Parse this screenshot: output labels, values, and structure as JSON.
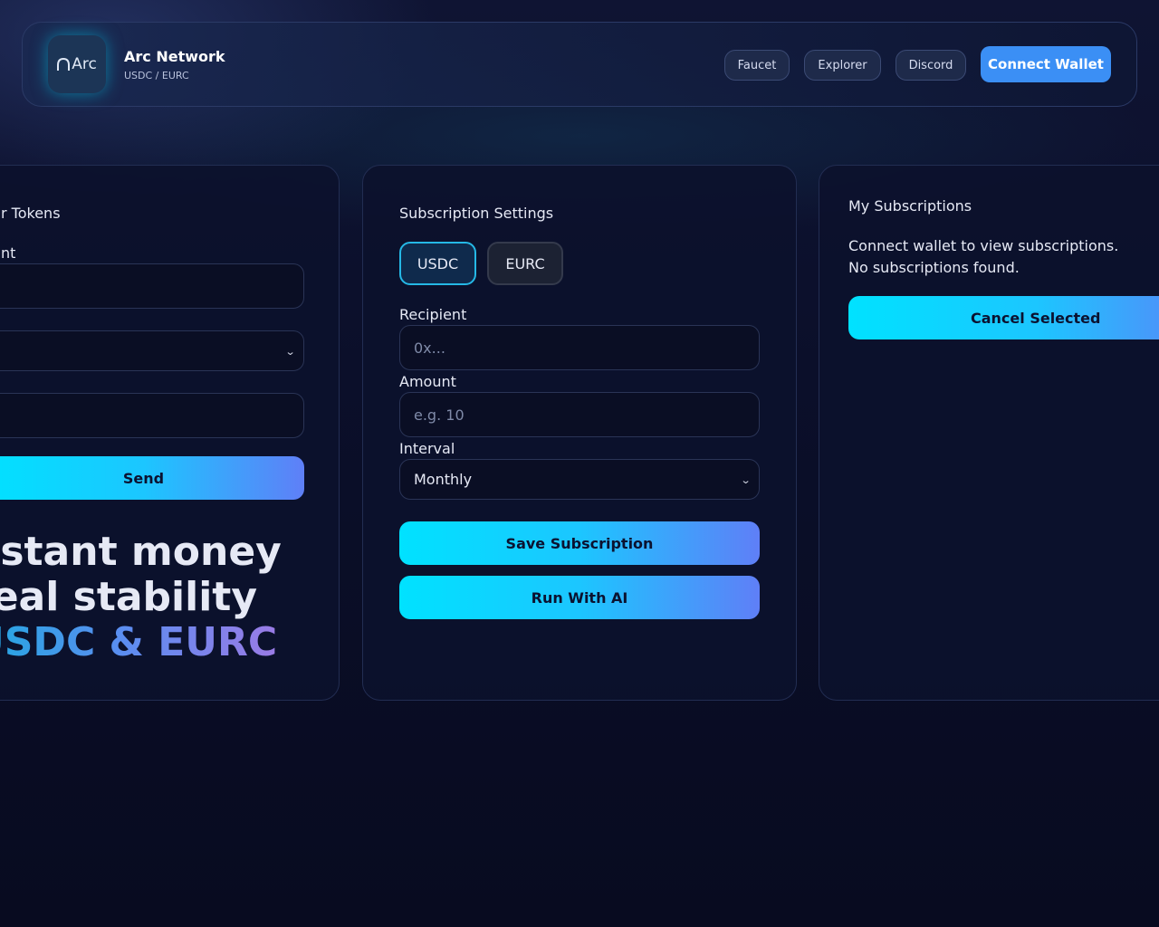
{
  "header": {
    "logo_text": "Arc",
    "title": "Arc Network",
    "subtitle": "USDC / EURC",
    "nav": [
      "Faucet",
      "Explorer",
      "Discord"
    ],
    "connect_label": "Connect Wallet"
  },
  "transfer": {
    "title_visible": "r Tokens",
    "field_label_visible": "nt",
    "send_label": "Send",
    "hero_line1": "nstant money",
    "hero_line2": "real stability",
    "hero_line3": "USDC & EURC"
  },
  "subscription": {
    "title": "Subscription Settings",
    "tokens": [
      "USDC",
      "EURC"
    ],
    "selected_token": "USDC",
    "recipient_label": "Recipient",
    "recipient_placeholder": "0x...",
    "amount_label": "Amount",
    "amount_placeholder": "e.g. 10",
    "interval_label": "Interval",
    "interval_value": "Monthly",
    "save_label": "Save Subscription",
    "ai_label": "Run With AI"
  },
  "my_subscriptions": {
    "title": "My Subscriptions",
    "line1": "Connect wallet to view subscriptions.",
    "line2": "No subscriptions found.",
    "cancel_label": "Cancel Selected"
  },
  "colors": {
    "accent_blue": "#3b8ff5",
    "cyan": "#00e2ff",
    "panel_bg": "#0c112c"
  }
}
